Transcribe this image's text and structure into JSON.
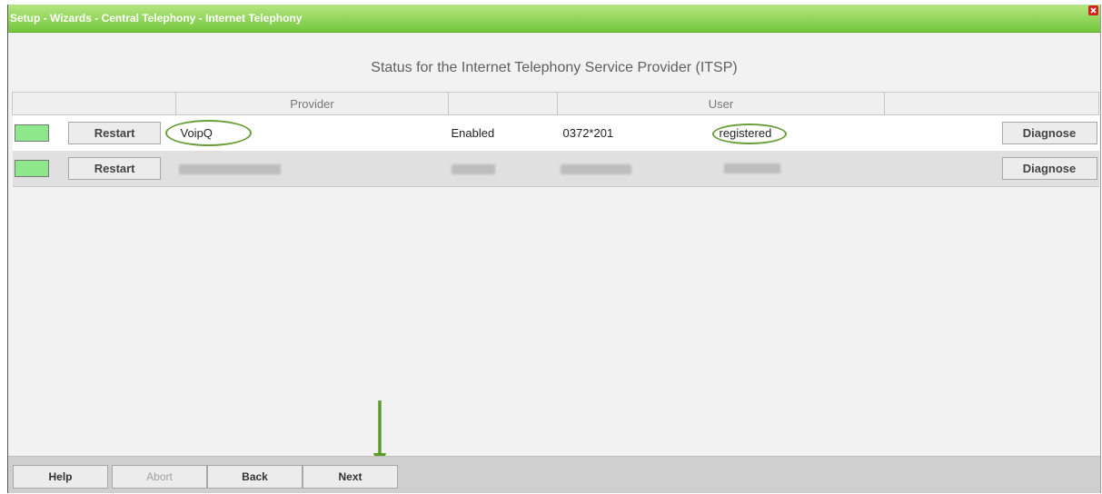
{
  "window": {
    "title": "Setup - Wizards - Central Telephony - Internet Telephony"
  },
  "page": {
    "title": "Status for the Internet Telephony Service Provider (ITSP)"
  },
  "table": {
    "headers": [
      "",
      "Provider",
      "",
      "User",
      ""
    ],
    "rows": [
      {
        "status_color": "#8ce88a",
        "restart_label": "Restart",
        "provider": "VoipQ",
        "state": "Enabled",
        "user": "0372*201",
        "registration": "registered",
        "diagnose_label": "Diagnose"
      },
      {
        "status_color": "#8ce88a",
        "restart_label": "Restart",
        "provider": "",
        "state": "",
        "user": "",
        "registration": "",
        "diagnose_label": "Diagnose"
      }
    ]
  },
  "footer": {
    "help_label": "Help",
    "abort_label": "Abort",
    "back_label": "Back",
    "next_label": "Next"
  },
  "colors": {
    "titlebar": "#74c73b",
    "highlight": "#6a9e3a",
    "status_ok": "#8ce88a"
  },
  "icons": {
    "close": "close-icon",
    "annotation": "arrow-down-icon"
  }
}
